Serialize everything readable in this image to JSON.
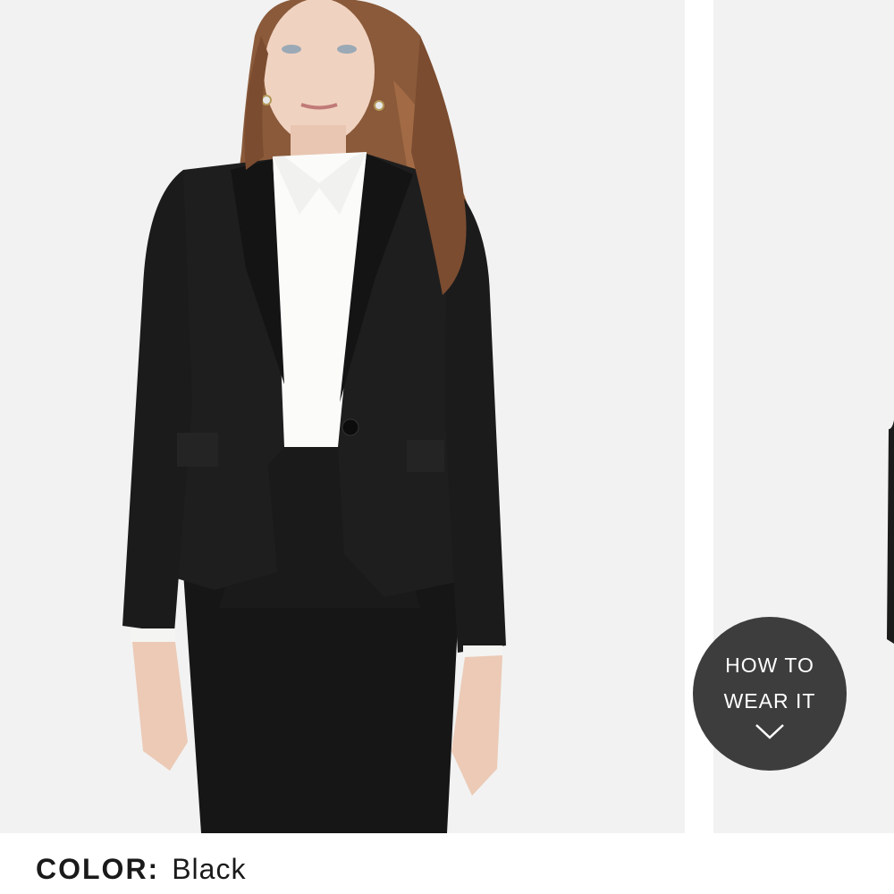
{
  "product_carousel": {
    "main_image": {
      "subject": "model-in-black-blazer-and-pencil-skirt",
      "background_color": "#f2f2f2"
    },
    "next_image_peek": {
      "background_color": "#f2f2f2"
    }
  },
  "how_to_wear": {
    "line1": "HOW TO",
    "line2": "WEAR IT",
    "icon": "chevron-down-icon",
    "background_color": "#3d3d3d"
  },
  "color_selector": {
    "label": "COLOR:",
    "value": "Black"
  }
}
